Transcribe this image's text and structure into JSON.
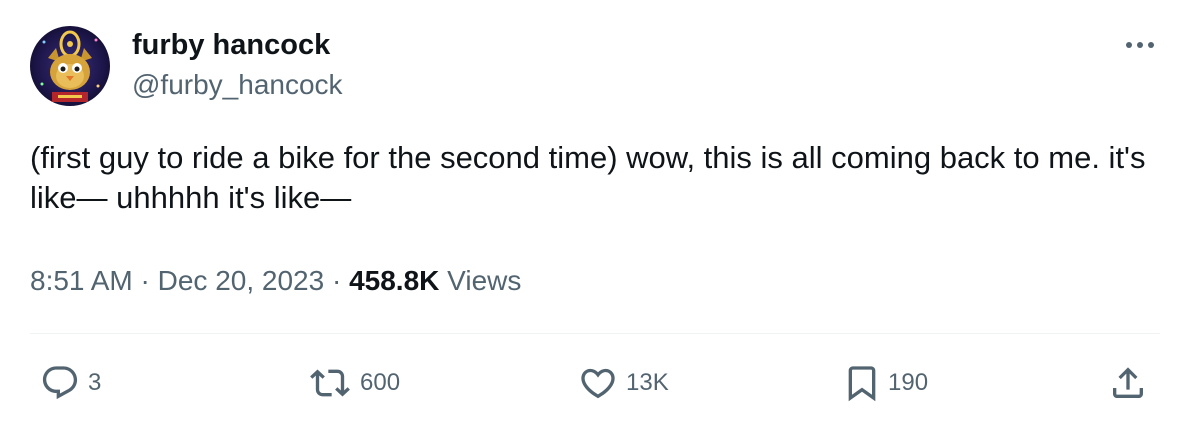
{
  "author": {
    "display_name": "furby hancock",
    "handle": "@furby_hancock"
  },
  "tweet": {
    "text": "(first guy to ride a bike for the second time) wow, this is all coming back to me. it's like— uhhhhh it's like—"
  },
  "meta": {
    "time": "8:51 AM",
    "separator": "·",
    "date": "Dec 20, 2023",
    "views_count": "458.8K",
    "views_label": "Views"
  },
  "actions": {
    "reply_count": "3",
    "retweet_count": "600",
    "like_count": "13K",
    "bookmark_count": "190"
  },
  "icons": {
    "more": "more-horizontal-icon",
    "reply": "reply-bubble-icon",
    "retweet": "retweet-icon",
    "like": "heart-icon",
    "bookmark": "bookmark-icon",
    "share": "share-upload-icon"
  },
  "colors": {
    "text_primary": "#0f1419",
    "text_secondary": "#536471",
    "divider": "#eff3f4"
  }
}
